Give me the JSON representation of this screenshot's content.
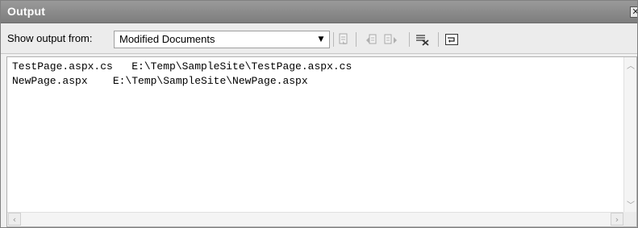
{
  "window": {
    "title": "Output"
  },
  "toolbar": {
    "show_output_label": "Show output from:",
    "source_selected": "Modified Documents",
    "icons": [
      "goto-source-icon",
      "find-previous-icon",
      "find-next-icon",
      "clear-all-icon",
      "word-wrap-icon"
    ]
  },
  "output": {
    "lines": [
      "TestPage.aspx.cs   E:\\Temp\\SampleSite\\TestPage.aspx.cs",
      "NewPage.aspx    E:\\Temp\\SampleSite\\NewPage.aspx"
    ]
  },
  "colors": {
    "titlebar": "#8a8a8a",
    "toolbar": "#ececec",
    "content_bg": "#ffffff"
  }
}
